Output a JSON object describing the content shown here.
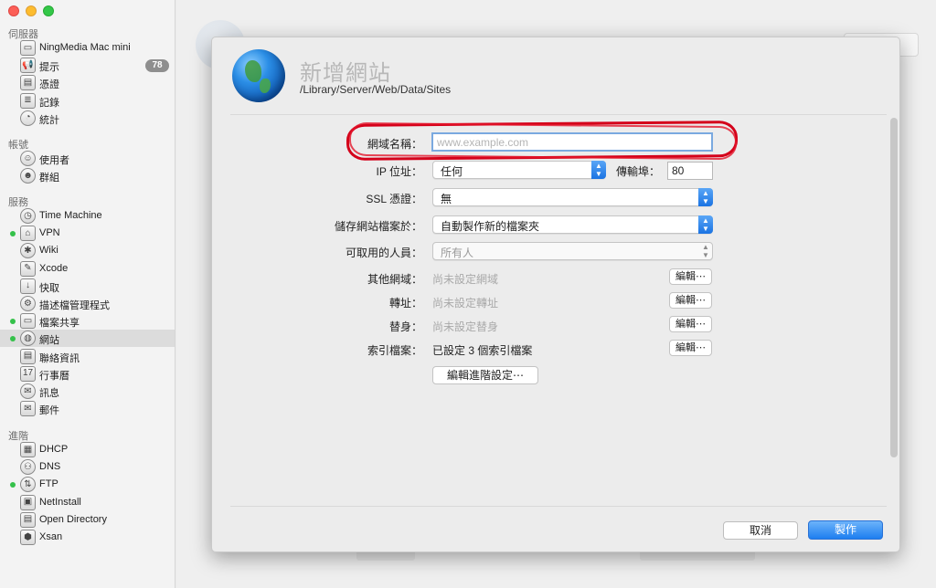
{
  "sidebar": {
    "sections": {
      "server": "伺服器",
      "accounts": "帳號",
      "services": "服務",
      "advanced": "進階"
    },
    "server_items": [
      {
        "label": "NingMedia Mac mini",
        "icon": "mac-mini-icon"
      },
      {
        "label": "提示",
        "icon": "alerts-icon",
        "badge": "78"
      },
      {
        "label": "憑證",
        "icon": "certificates-icon"
      },
      {
        "label": "記錄",
        "icon": "logs-icon"
      },
      {
        "label": "統計",
        "icon": "stats-icon"
      }
    ],
    "account_items": [
      {
        "label": "使用者",
        "icon": "user-icon"
      },
      {
        "label": "群組",
        "icon": "group-icon"
      }
    ],
    "service_items": [
      {
        "label": "Time Machine",
        "icon": "time-machine-icon",
        "active": false
      },
      {
        "label": "VPN",
        "icon": "vpn-lock-icon",
        "active": true
      },
      {
        "label": "Wiki",
        "icon": "wiki-icon",
        "active": false
      },
      {
        "label": "Xcode",
        "icon": "xcode-icon",
        "active": false
      },
      {
        "label": "快取",
        "icon": "caching-icon",
        "active": false
      },
      {
        "label": "描述檔管理程式",
        "icon": "profile-manager-icon",
        "active": false
      },
      {
        "label": "檔案共享",
        "icon": "file-sharing-icon",
        "active": true
      },
      {
        "label": "網站",
        "icon": "websites-icon",
        "active": true,
        "selected": true
      },
      {
        "label": "聯絡資訊",
        "icon": "contacts-icon",
        "active": false
      },
      {
        "label": "行事曆",
        "icon": "calendar-icon",
        "active": false,
        "glyph": "17"
      },
      {
        "label": "訊息",
        "icon": "messages-icon",
        "active": false
      },
      {
        "label": "郵件",
        "icon": "mail-icon",
        "active": false
      }
    ],
    "advanced_items": [
      {
        "label": "DHCP",
        "icon": "dhcp-icon",
        "active": false
      },
      {
        "label": "DNS",
        "icon": "dns-icon",
        "active": false
      },
      {
        "label": "FTP",
        "icon": "ftp-icon",
        "active": true
      },
      {
        "label": "NetInstall",
        "icon": "netinstall-icon",
        "active": false
      },
      {
        "label": "Open Directory",
        "icon": "open-directory-icon",
        "active": false
      },
      {
        "label": "Xsan",
        "icon": "xsan-icon",
        "active": false
      }
    ]
  },
  "sheet": {
    "title": "新增網站",
    "path": "/Library/Server/Web/Data/Sites",
    "fields": {
      "domain_label": "網域名稱：",
      "domain_placeholder": "www.example.com",
      "ip_label": "IP 位址：",
      "ip_value": "任何",
      "port_label": "傳輸埠：",
      "port_value": "80",
      "ssl_label": "SSL 憑證：",
      "ssl_value": "無",
      "store_label": "儲存網站檔案於：",
      "store_value": "自動製作新的檔案夾",
      "access_label": "可取用的人員：",
      "access_value": "所有人",
      "other_domains_label": "其他網域：",
      "other_domains_value": "尚未設定網域",
      "redirects_label": "轉址：",
      "redirects_value": "尚未設定轉址",
      "aliases_label": "替身：",
      "aliases_value": "尚未設定替身",
      "index_label": "索引檔案：",
      "index_value": "已設定 3 個索引檔案",
      "edit_button": "編輯⋯",
      "advanced_button": "編輯進階設定⋯"
    },
    "cancel_button": "取消",
    "create_button": "製作"
  },
  "colors": {
    "accent": "#1d7ef0",
    "highlight_marker": "#d4001a",
    "active_dot": "#35c14a"
  }
}
